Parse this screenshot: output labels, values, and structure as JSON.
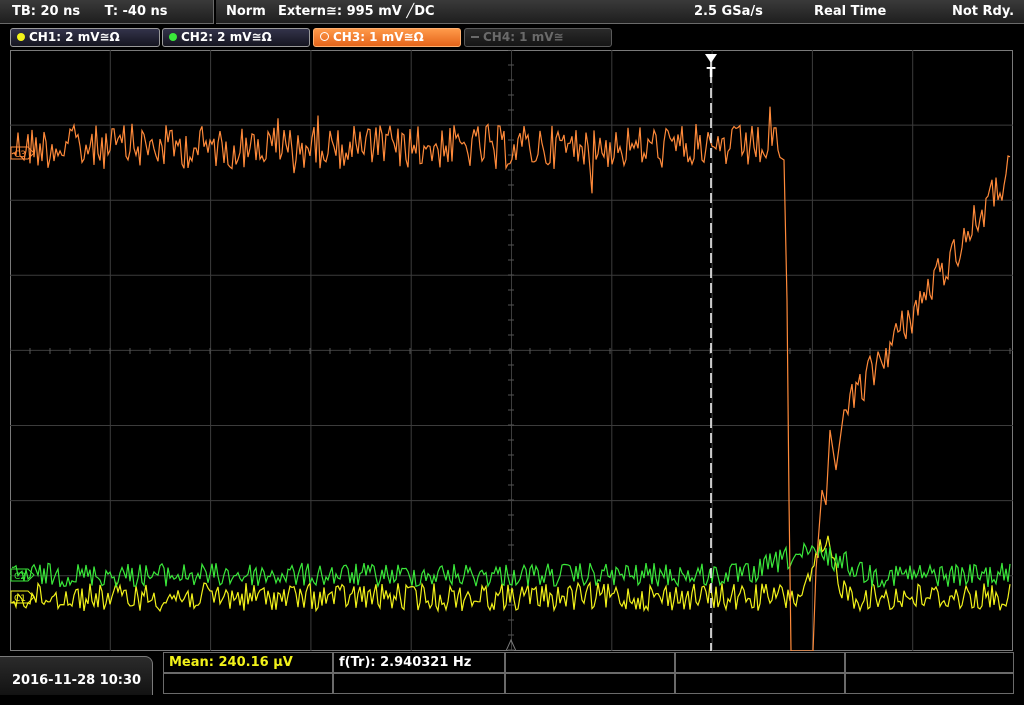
{
  "header": {
    "timebase": "TB: 20 ns",
    "trigger_time": "T: -40 ns",
    "mode": "Norm",
    "trigger_source": "Extern≅: 995 mV ╱DC",
    "sample_rate": "2.5 GSa/s",
    "acquisition": "Real Time",
    "status": "Not Rdy."
  },
  "channels": [
    {
      "label": "CH1: 2 mV≅Ω",
      "color": "#f2f21a",
      "active": true
    },
    {
      "label": "CH2: 2 mV≅Ω",
      "color": "#3ae83a",
      "active": true
    },
    {
      "label": "CH3: 1 mV≅Ω",
      "color": "#ff8a3a",
      "active": true
    },
    {
      "label": "CH4: 1 mV≅",
      "color": "#6a6a6a",
      "active": false
    }
  ],
  "markers": {
    "ch3": "C3",
    "ch2": "C2",
    "ch1": "C1",
    "trigger": "T"
  },
  "measurements": {
    "mean": "Mean: 240.16 µV",
    "frequency": "f(Tr): 2.940321 Hz"
  },
  "footer": {
    "datetime": "2016-11-28 10:30"
  },
  "colors": {
    "ch1": "#f2f21a",
    "ch2": "#3ae83a",
    "ch3": "#ff8a3a",
    "grid": "#4a4a4a"
  }
}
